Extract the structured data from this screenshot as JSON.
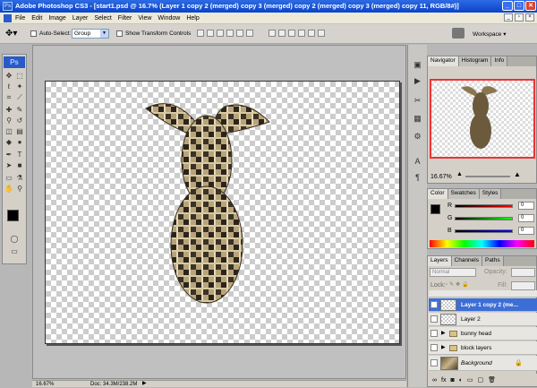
{
  "window": {
    "title": "Adobe Photoshop CS3 - [start1.psd @ 16.7% (Layer 1 copy 2 (merged) copy 3 (merged) copy 2 (merged) copy 3 (merged) copy 11, RGB/8#)]"
  },
  "menu": [
    "File",
    "Edit",
    "Image",
    "Layer",
    "Select",
    "Filter",
    "View",
    "Window",
    "Help"
  ],
  "options": {
    "auto_select_label": "Auto-Select:",
    "auto_select_value": "Group",
    "show_transform_label": "Show Transform Controls",
    "workspace_label": "Workspace ▾"
  },
  "toolbox": {
    "logo": "Ps"
  },
  "status": {
    "zoom": "16.67%",
    "doc_info": "Doc: 34.3M/238.2M"
  },
  "navigator": {
    "tabs": [
      "Navigator",
      "Histogram",
      "Info"
    ],
    "zoom": "16.67%"
  },
  "color_panel": {
    "tabs": [
      "Color",
      "Swatches",
      "Styles"
    ],
    "channels": [
      {
        "label": "R",
        "value": "0"
      },
      {
        "label": "G",
        "value": "0"
      },
      {
        "label": "B",
        "value": "0"
      }
    ]
  },
  "layers_panel": {
    "tabs": [
      "Layers",
      "Channels",
      "Paths"
    ],
    "blend_mode": "Normal",
    "opacity_label": "Opacity:",
    "lock_label": "Lock:",
    "fill_label": "Fill:",
    "layers": [
      {
        "name": "Layer 1 copy 2 (me...",
        "type": "layer",
        "selected": true
      },
      {
        "name": "Layer 2",
        "type": "layer",
        "selected": false
      },
      {
        "name": "bunny head",
        "type": "group",
        "selected": false
      },
      {
        "name": "block layers",
        "type": "group",
        "selected": false
      },
      {
        "name": "Background",
        "type": "background",
        "selected": false
      }
    ]
  },
  "colors": {
    "accent": "#3c6ed6",
    "title_blue": "#0a43c8"
  }
}
